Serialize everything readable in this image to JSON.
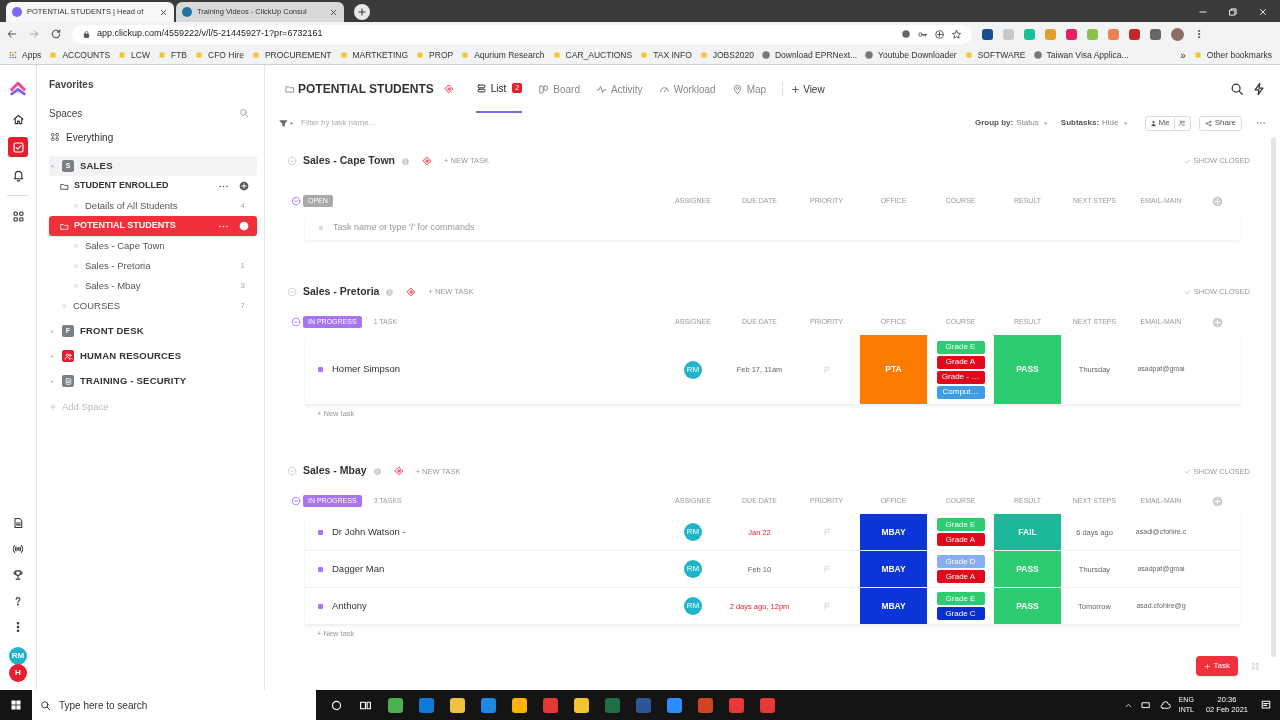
{
  "browser": {
    "tabs": [
      {
        "title": "POTENTIAL STUDENTS | Head of",
        "selected": true
      },
      {
        "title": "Training Videos - ClickUp Consul",
        "selected": false
      }
    ],
    "url": "app.clickup.com/4559222/v/l/5-21445927-1?pr=6732161",
    "bookmarks": [
      {
        "label": "Apps",
        "kind": "apps"
      },
      {
        "label": "ACCOUNTS",
        "kind": "folder"
      },
      {
        "label": "LCW",
        "kind": "folder"
      },
      {
        "label": "FTB",
        "kind": "folder"
      },
      {
        "label": "CFO Hire",
        "kind": "folder"
      },
      {
        "label": "PROCUREMENT",
        "kind": "folder"
      },
      {
        "label": "MARTKETING",
        "kind": "folder"
      },
      {
        "label": "PROP",
        "kind": "folder"
      },
      {
        "label": "Aqurium Research",
        "kind": "folder"
      },
      {
        "label": "CAR_AUCTIONS",
        "kind": "folder"
      },
      {
        "label": "TAX INFO",
        "kind": "folder"
      },
      {
        "label": "JOBS2020",
        "kind": "folder"
      },
      {
        "label": "Download EPRNext...",
        "kind": "web"
      },
      {
        "label": "Youtube Downloader",
        "kind": "web"
      },
      {
        "label": "SOFTWARE",
        "kind": "folder"
      },
      {
        "label": "Taiwan Visa Applica...",
        "kind": "web"
      }
    ],
    "more": "»",
    "other_bookmarks": "Other bookmarks"
  },
  "rail": {
    "items": [
      {
        "kind": "home",
        "selected": false
      },
      {
        "kind": "tasks",
        "selected": true
      },
      {
        "kind": "bell",
        "selected": false
      },
      {
        "kind": "apps",
        "selected": false
      }
    ],
    "bottom_items": [
      {
        "kind": "doc"
      },
      {
        "kind": "broadcast"
      },
      {
        "kind": "trophy"
      },
      {
        "kind": "help"
      },
      {
        "kind": "more"
      }
    ],
    "avatars": [
      {
        "initials": "RM",
        "color": "#1fb5c9"
      },
      {
        "initials": "H",
        "color": "#e5202e"
      }
    ]
  },
  "sidebar": {
    "favorites": "Favorites",
    "spaces_label": "Spaces",
    "everything": "Everything",
    "spaces": [
      {
        "kind": "letter",
        "initial": "S",
        "name": "SALES",
        "color": "#7b7f86",
        "expanded": true,
        "children": [
          {
            "kind": "folder",
            "name": "STUDENT ENROLLED",
            "selected": false,
            "children": [
              {
                "name": "Details of All Students",
                "count": "4",
                "selected": false
              }
            ]
          },
          {
            "kind": "folder",
            "name": "POTENTIAL STUDENTS",
            "selected": true,
            "children": [
              {
                "name": "Sales - Cape Town",
                "selected": false
              },
              {
                "name": "Sales - Pretoria",
                "count": "1",
                "selected": false
              },
              {
                "name": "Sales - Mbay",
                "count": "3",
                "selected": false
              }
            ]
          },
          {
            "kind": "list",
            "name": "COURSES",
            "count": "7",
            "selected": false
          }
        ]
      },
      {
        "kind": "letter",
        "initial": "F",
        "name": "FRONT DESK",
        "color": "#7b7f86",
        "expanded": false
      },
      {
        "kind": "people",
        "name": "HUMAN RESOURCES",
        "color": "#e5202e",
        "expanded": false
      },
      {
        "kind": "document",
        "name": "TRAINING - SECURITY",
        "color": "#7b7f86",
        "expanded": false
      }
    ],
    "add_space": "Add Space"
  },
  "header": {
    "title": "POTENTIAL STUDENTS",
    "views": [
      {
        "label": "List",
        "kind": "list",
        "selected": true,
        "badge": "2"
      },
      {
        "label": "Board",
        "kind": "board",
        "selected": false
      },
      {
        "label": "Activity",
        "kind": "activity",
        "selected": false
      },
      {
        "label": "Workload",
        "kind": "workload",
        "selected": false
      },
      {
        "label": "Map",
        "kind": "map",
        "selected": false
      }
    ],
    "add_view": "View"
  },
  "toolbar": {
    "filter_placeholder": "Filter by task name...",
    "group_by_label": "Group by:",
    "group_by_value": "Status",
    "subtasks_label": "Subtasks:",
    "subtasks_value": "Hide",
    "me": "Me",
    "share": "Share"
  },
  "groups": [
    {
      "name": "Sales - Cape Town",
      "new_task": "+ NEW TASK",
      "show_closed": "SHOW CLOSED",
      "status": {
        "label": "OPEN",
        "color": "#a9a9a9"
      },
      "columns": [
        "ASSIGNEE",
        "DUE DATE",
        "PRIORITY",
        "OFFICE",
        "COURSE",
        "RESULT",
        "NEXT STEPS",
        "EMAIL-MAIN"
      ],
      "composer_placeholder": "Task name or type '/' for commands"
    },
    {
      "name": "Sales - Pretoria",
      "new_task": "+ NEW TASK",
      "show_closed": "SHOW CLOSED",
      "status": {
        "label": "IN PROGRESS",
        "color": "#a875f0"
      },
      "count": "1 TASK",
      "columns": [
        "ASSIGNEE",
        "DUE DATE",
        "PRIORITY",
        "OFFICE",
        "COURSE",
        "RESULT",
        "NEXT STEPS",
        "EMAIL-MAIN"
      ],
      "rows": [
        {
          "name": "Homer Simpson",
          "assignee": "RM",
          "due": "Feb 17, 11am",
          "overdue": false,
          "office": {
            "label": "PTA",
            "color": "#fb7a00"
          },
          "course": [
            {
              "label": "Grade E",
              "color": "#2ecc71"
            },
            {
              "label": "Grade A",
              "color": "#df0b1a"
            },
            {
              "label": "Grade - …",
              "color": "#df0b1a"
            },
            {
              "label": "Comput…",
              "color": "#3b9ee6"
            }
          ],
          "result": {
            "label": "PASS",
            "color": "#2ecc71"
          },
          "next_steps": "Thursday",
          "email": "asadpat@gmai"
        }
      ],
      "add_task": "+ New task"
    },
    {
      "name": "Sales - Mbay",
      "new_task": "+ NEW TASK",
      "show_closed": "SHOW CLOSED",
      "status": {
        "label": "IN PROGRESS",
        "color": "#a875f0"
      },
      "count": "3 TASKS",
      "columns": [
        "ASSIGNEE",
        "DUE DATE",
        "PRIORITY",
        "OFFICE",
        "COURSE",
        "RESULT",
        "NEXT STEPS",
        "EMAIL-MAIN"
      ],
      "rows": [
        {
          "name": "Dr John Watson -",
          "assignee": "RM",
          "due": "Jan 22",
          "overdue": true,
          "office": {
            "label": "MBAY",
            "color": "#0b34d9"
          },
          "course": [
            {
              "label": "Grade E",
              "color": "#2ecc71"
            },
            {
              "label": "Grade A",
              "color": "#df0b1a"
            }
          ],
          "result": {
            "label": "FAIL",
            "color": "#1bb99a"
          },
          "next_steps": "6 days ago",
          "email": "asadi@cfohire.c"
        },
        {
          "name": "Dagger Man",
          "assignee": "RM",
          "due": "Feb 10",
          "overdue": false,
          "office": {
            "label": "MBAY",
            "color": "#0b34d9"
          },
          "course": [
            {
              "label": "Grade D",
              "color": "#86aef0"
            },
            {
              "label": "Grade A",
              "color": "#df0b1a"
            }
          ],
          "result": {
            "label": "PASS",
            "color": "#2ecc71"
          },
          "next_steps": "Thursday",
          "email": "asadpat@gmai"
        },
        {
          "name": "Anthony",
          "assignee": "RM",
          "due": "2 days ago, 12pm",
          "overdue": true,
          "office": {
            "label": "MBAY",
            "color": "#0b34d9"
          },
          "course": [
            {
              "label": "Grade E",
              "color": "#2ecc71"
            },
            {
              "label": "Grade C",
              "color": "#0a2fd1"
            }
          ],
          "result": {
            "label": "PASS",
            "color": "#2ecc71"
          },
          "next_steps": "Tomorrow",
          "email": "asad.cfohire@g"
        }
      ],
      "add_task": "+ New task"
    }
  ],
  "task_button": "Task",
  "taskbar": {
    "search_placeholder": "Type here to search",
    "language": "ENG",
    "layout": "INTL",
    "time": "20:36",
    "date": "02 Feb 2021"
  }
}
